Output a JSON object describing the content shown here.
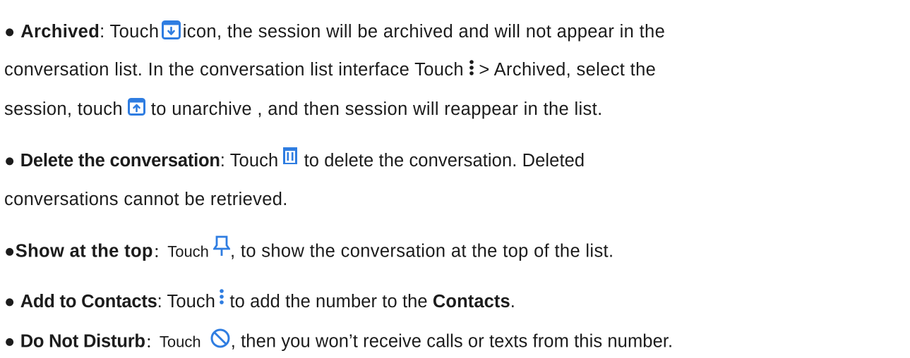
{
  "icon_color": "#2f7de1",
  "bullet": "●",
  "items": {
    "archived": {
      "title": "Archived",
      "t1": ": Touch ",
      "t2": "icon, the session will be archived and will not appear in the",
      "line2a": "conversation list. In the conversation list interface Touch ",
      "line2b": "> Archived, select the",
      "line3a": "session, touch ",
      "line3b": " to unarchive , and then session will reappear in the list.",
      "icons": [
        "archive-icon",
        "more-vert-icon",
        "unarchive-icon"
      ]
    },
    "delete": {
      "title": "Delete the conversation",
      "t1": ": Touch ",
      "t2": " to delete the conversation. Deleted",
      "line2": "conversations cannot be retrieved.",
      "icons": [
        "trash-icon"
      ]
    },
    "pin": {
      "title": "Show at the top",
      "colon": "：",
      "t1": "Touch ",
      "t2": ", to show the conversation at the top of the list.",
      "icons": [
        "pin-icon"
      ]
    },
    "contacts": {
      "title": "Add to Contacts",
      "t1": ": Touch ",
      "t2": " to add the number to the ",
      "bold2": "Contacts",
      "t3": ".",
      "icons": [
        "more-vert-icon"
      ]
    },
    "dnd": {
      "title": "Do Not Disturb",
      "colon": "：",
      "t1": "Touch ",
      "t2": ", then you won’t receive calls or texts from this number.",
      "icons": [
        "block-icon"
      ]
    }
  }
}
